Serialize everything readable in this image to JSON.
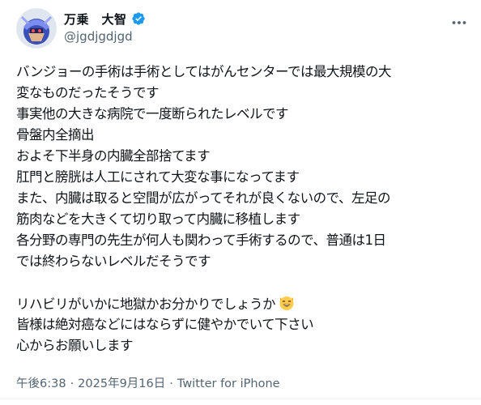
{
  "author": {
    "display_name": "万乗　大智",
    "handle": "@jgdjgdjgd",
    "verified_icon": "verified-badge-icon",
    "verified_color": "#1d9bf0"
  },
  "tweet": {
    "lines": [
      "バンジョーの手術は手術としてはがんセンターでは最大規模の大",
      "変なものだったそうです",
      "事実他の大きな病院で一度断られたレベルです",
      "骨盤内全摘出",
      "およそ下半身の内臓全部捨てます",
      "肛門と膀胱は人工にされて大変な事になってます",
      "また、内臓は取ると空間が広がってそれが良くないので、左足の",
      "筋肉などを大きくて切り取って内臓に移植します",
      "各分野の専門の先生が何人も関わって手術するので、普通は1日",
      "では終わらないレベルだそうです",
      "",
      "リハビリがいかに地獄かお分かりでしょうか",
      "皆様は絶対癌などにはならずに健やかでいて下さい",
      "心からお願いします"
    ],
    "emoji": "smiling-cat-icon"
  },
  "meta": {
    "time": "午後6:38",
    "separator": "·",
    "date": "2025年9月16日",
    "source": "Twitter for iPhone"
  },
  "icons": {
    "more": "more-options-icon"
  }
}
